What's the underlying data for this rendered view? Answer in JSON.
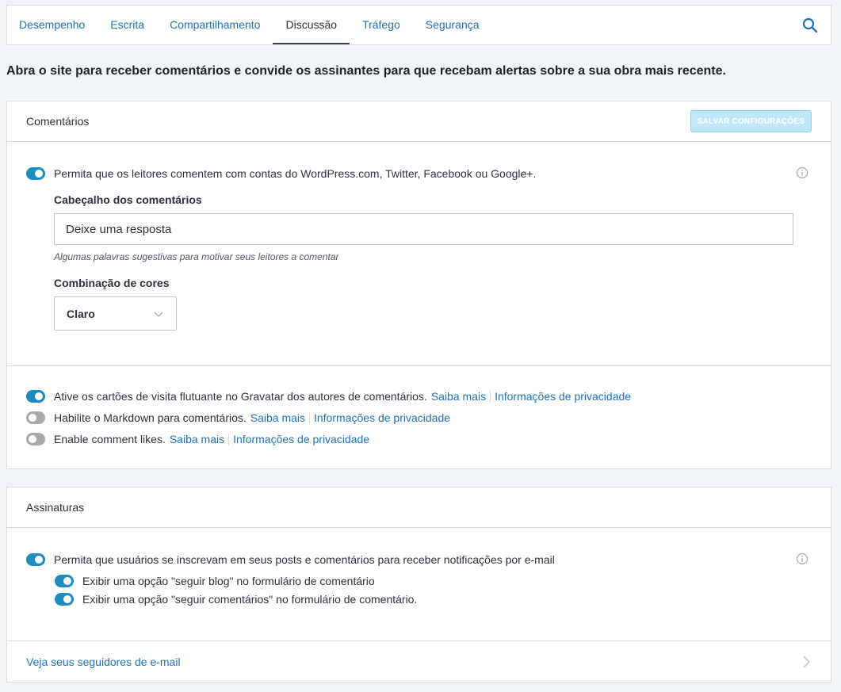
{
  "tabs": [
    {
      "label": "Desempenho",
      "active": false
    },
    {
      "label": "Escrita",
      "active": false
    },
    {
      "label": "Compartilhamento",
      "active": false
    },
    {
      "label": "Discussão",
      "active": true
    },
    {
      "label": "Tráfego",
      "active": false
    },
    {
      "label": "Segurança",
      "active": false
    }
  ],
  "intro": "Abra o site para receber comentários e convide os assinantes para que recebam alertas sobre a sua obra mais recente.",
  "comments": {
    "title": "Comentários",
    "save_label": "SALVAR CONFIGURAÇÕES",
    "social_login": {
      "label": "Permita que os leitores comentem com contas do WordPress.com, Twitter, Facebook ou Google+.",
      "enabled": true
    },
    "header_label": "Cabeçalho dos comentários",
    "header_value": "Deixe uma resposta",
    "header_hint": "Algumas palavras sugestivas para motivar seus leitores a comentar",
    "color_label": "Combinação de cores",
    "color_value": "Claro",
    "gravatar": {
      "label": "Ative os cartões de visita flutuante no Gravatar dos autores de comentários.",
      "enabled": true
    },
    "markdown": {
      "label": "Habilite o Markdown para comentários.",
      "enabled": false
    },
    "likes": {
      "label": "Enable comment likes.",
      "enabled": false
    },
    "learn_more": "Saiba mais",
    "privacy_info": "Informações de privacidade"
  },
  "subscriptions": {
    "title": "Assinaturas",
    "main": {
      "label": "Permita que usuários se inscrevam em seus posts e comentários para receber notificações por e-mail",
      "enabled": true
    },
    "follow_blog": {
      "label": "Exibir uma opção \"seguir blog\" no formulário de comentário",
      "enabled": true
    },
    "follow_comments": {
      "label": "Exibir uma opção \"seguir comentários\" no formulário de comentário.",
      "enabled": true
    },
    "followers_link": "Veja seus seguidores de e-mail"
  },
  "colors": {
    "accent": "#2271b1",
    "toggle_on": "#1e8cbe",
    "toggle_off": "#a7aaad"
  }
}
